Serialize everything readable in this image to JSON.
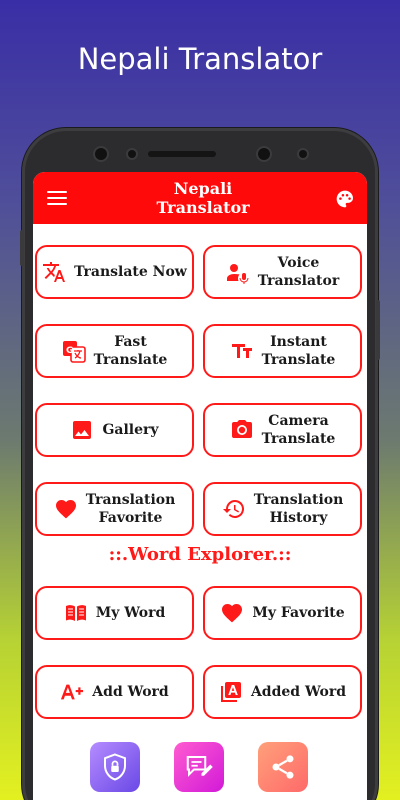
{
  "promo": {
    "title": "Nepali Translator"
  },
  "appbar": {
    "title": "Nepali\nTranslator",
    "menu_icon": "hamburger-menu-icon",
    "palette_icon": "palette-icon"
  },
  "colors": {
    "accent": "#ff0a0a",
    "card_border": "#ff1a1a",
    "bg_top": "#3a2ea6",
    "bg_bottom": "#e3f020"
  },
  "features": [
    {
      "label": "Translate Now",
      "icon": "translate-icon"
    },
    {
      "label": "Voice\nTranslator",
      "icon": "voice-person-icon"
    },
    {
      "label": "Fast\nTranslate",
      "icon": "google-translate-icon"
    },
    {
      "label": "Instant\nTranslate",
      "icon": "text-size-icon"
    },
    {
      "label": "Gallery",
      "icon": "image-icon"
    },
    {
      "label": "Camera\nTranslate",
      "icon": "camera-icon"
    },
    {
      "label": "Translation\nFavorite",
      "icon": "heart-icon"
    },
    {
      "label": "Translation\nHistory",
      "icon": "history-icon"
    }
  ],
  "word_explorer": {
    "heading": "::.Word Explorer.::",
    "items": [
      {
        "label": "My Word",
        "icon": "book-icon"
      },
      {
        "label": "My Favorite",
        "icon": "heart-icon"
      },
      {
        "label": "Add Word",
        "icon": "a-plus-icon"
      },
      {
        "label": "Added Word",
        "icon": "letter-a-box-icon"
      }
    ]
  },
  "bottom_bar": [
    {
      "icon": "privacy-shield-icon"
    },
    {
      "icon": "feedback-edit-icon"
    },
    {
      "icon": "share-icon"
    }
  ]
}
